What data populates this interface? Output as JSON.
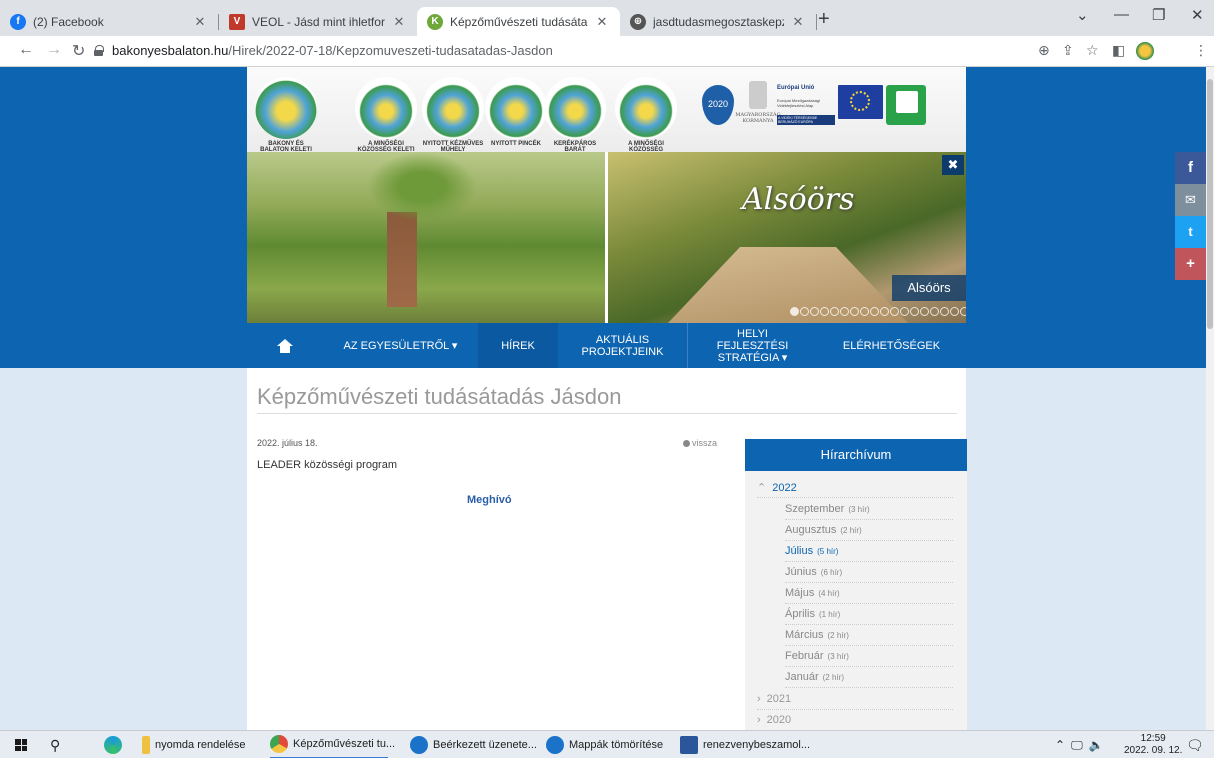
{
  "browser": {
    "tabs": [
      {
        "title": "(2) Facebook",
        "fav_color": "#1877f2",
        "fav_text": "f"
      },
      {
        "title": "VEOL - Jásd mint ihletforrás: egy",
        "fav_color": "#c0392b",
        "fav_text": "V"
      },
      {
        "title": "Képzőművészeti tudásátadás Jás",
        "fav_color": "#6ea83a",
        "fav_text": "K"
      },
      {
        "title": "jasdtudasmegosztaskepzomuves",
        "fav_color": "#555555",
        "fav_text": "⊕"
      }
    ],
    "new_tab": "+",
    "url_domain": "bakonyesbalaton.hu",
    "url_path": "/Hirek/2022-07-18/Kepzomuveszeti-tudasatadas-Jasdon"
  },
  "header": {
    "logos": [
      {
        "text": "BAKONY ÉS BALATON KELETI KAPUJA",
        "color": "#2a7fc4"
      },
      {
        "text": "A MINŐSÉGI KÖZÖSSÉG KELETI KAPUJA",
        "color": "#3b9a4a"
      },
      {
        "text": "NYITOTT KÉZMŰVES MŰHELY",
        "color": "#3b9a4a"
      },
      {
        "text": "NYITOTT PINCÉK",
        "color": "#3b9a4a"
      },
      {
        "text": "KERÉKPÁROS BARÁT",
        "color": "#3b9a4a"
      },
      {
        "text": "A MINŐSÉGI KÖZÖSSÉG",
        "color": "#3b9a4a"
      }
    ],
    "szechenyi": "2020",
    "gov_text": "MAGYARORSZÁG KORMÁNYA",
    "eu_title": "Európai Unió",
    "eu_sub": "Európai Mezőgazdasági Vidékfejlesztési Alap",
    "eu_bar": "A VIDÉKI TÉRSÉGEKBE BERUHÁZÓ EURÓPA"
  },
  "hero": {
    "title": "Alsóörs",
    "caption": "Alsóörs",
    "close": "✖",
    "dot_count": 20,
    "active_dot": 0
  },
  "nav": [
    {
      "label": "",
      "icon": "home-icon",
      "width": 76
    },
    {
      "label": "AZ EGYESÜLETRŐL ▾",
      "width": 155
    },
    {
      "label": "HÍREK",
      "width": 80,
      "current": true
    },
    {
      "label": "AKTUÁLIS PROJEKTJEINK",
      "width": 130
    },
    {
      "label": "HELYI FEJLESZTÉSI STRATÉGIA ▾",
      "width": 129
    },
    {
      "label": "ELÉRHETŐSÉGEK",
      "width": 149
    }
  ],
  "social": [
    {
      "name": "facebook-icon",
      "glyph": "f",
      "color": "#3b5998"
    },
    {
      "name": "mail-icon",
      "glyph": "✉",
      "color": "#7d8e9c"
    },
    {
      "name": "twitter-icon",
      "glyph": "🐦",
      "color": "#1da1f2"
    },
    {
      "name": "share-plus-icon",
      "glyph": "+",
      "color": "#c0555b"
    }
  ],
  "article": {
    "title": "Képzőművészeti tudásátadás Jásdon",
    "date": "2022. július 18.",
    "back": "vissza",
    "lead": "LEADER közösségi program",
    "link": "Meghívó"
  },
  "archive": {
    "title": "Hírarchívum",
    "open_year": "2022",
    "months": [
      {
        "name": "Szeptember",
        "count": "(3 hír)"
      },
      {
        "name": "Augusztus",
        "count": "(2 hír)"
      },
      {
        "name": "Július",
        "count": "(5 hír)",
        "current": true
      },
      {
        "name": "Június",
        "count": "(6 hír)"
      },
      {
        "name": "Május",
        "count": "(4 hír)"
      },
      {
        "name": "Április",
        "count": "(1 hír)"
      },
      {
        "name": "Március",
        "count": "(2 hír)"
      },
      {
        "name": "Február",
        "count": "(3 hír)"
      },
      {
        "name": "Január",
        "count": "(2 hír)"
      }
    ],
    "other_years": [
      "2021",
      "2020"
    ]
  },
  "taskbar": {
    "items": [
      {
        "label": "nyomda rendelése",
        "color": "#f0c040"
      },
      {
        "label": "Képzőművészeti tu...",
        "color": "#e04a3a",
        "active": true
      },
      {
        "label": "Beérkezett üzenete...",
        "color": "#1a73c8"
      },
      {
        "label": "Mappák tömörítése",
        "color": "#1a73c8"
      },
      {
        "label": "renezvenybeszamol...",
        "color": "#2b579a"
      }
    ],
    "time": "12:59",
    "date": "2022. 09. 12."
  }
}
